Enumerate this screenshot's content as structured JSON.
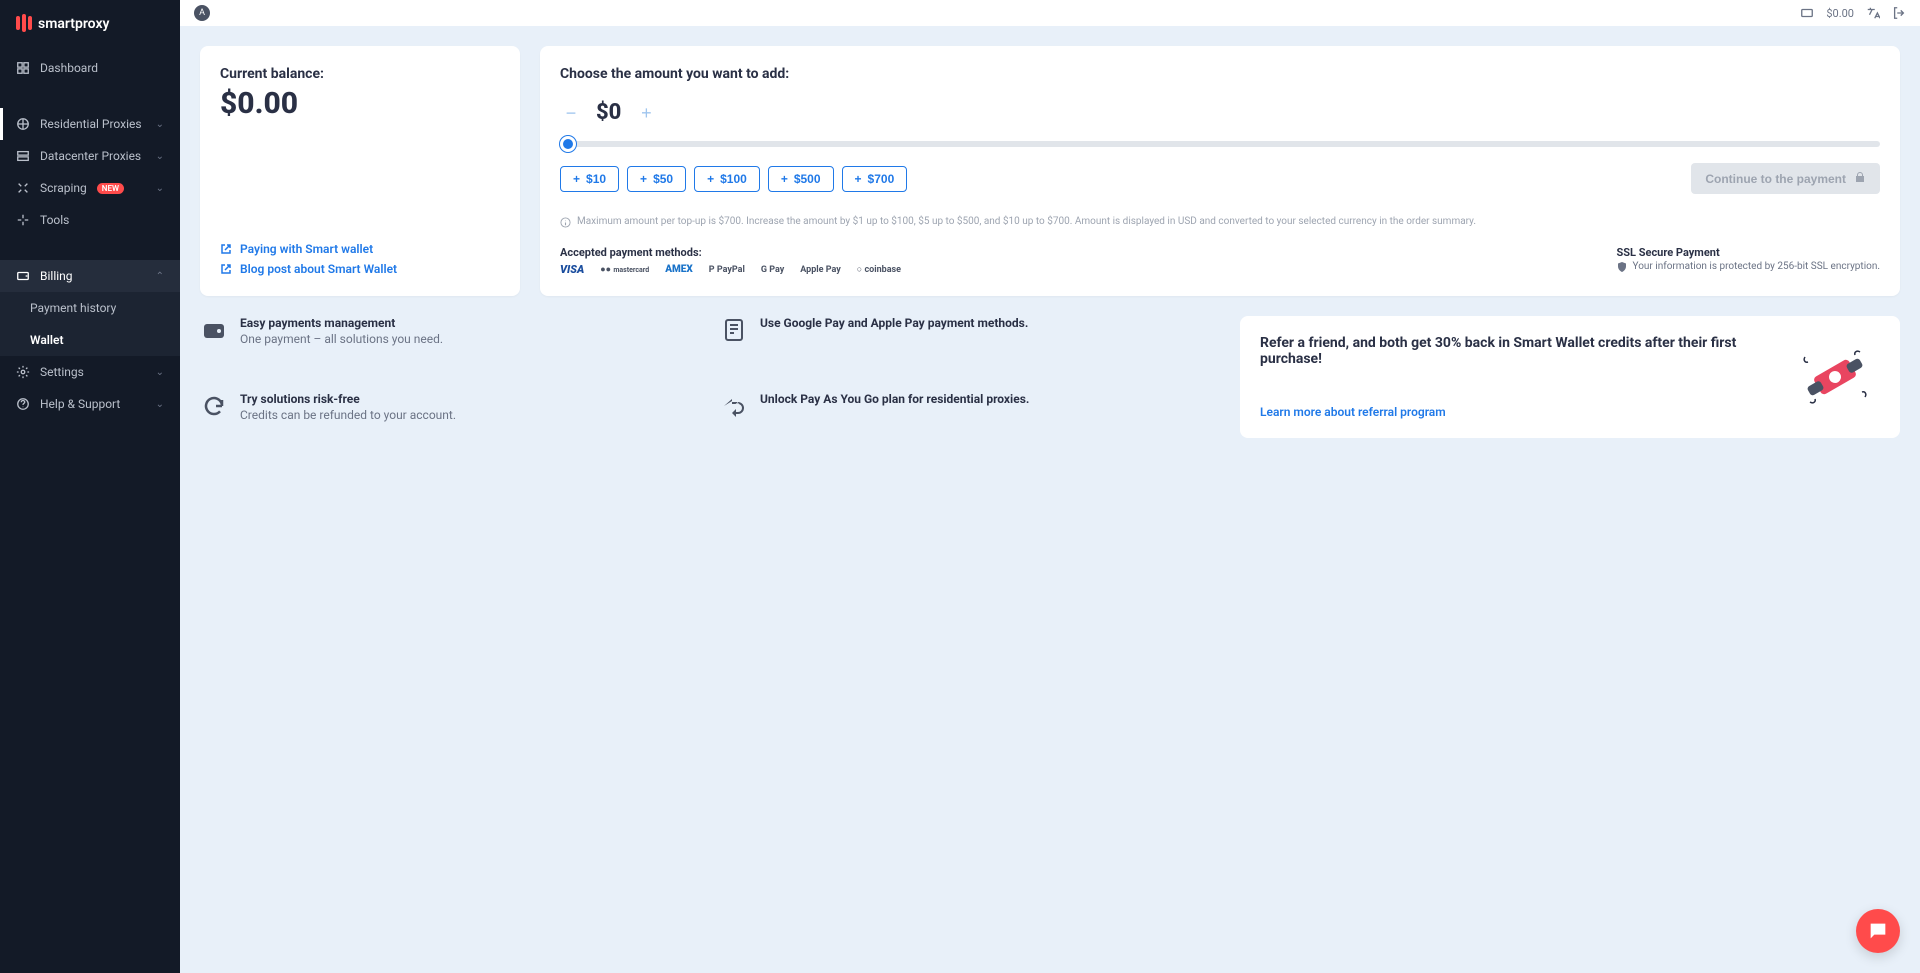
{
  "brand": "smartproxy",
  "topbar": {
    "avatar_initial": "A",
    "balance": "$0.00"
  },
  "sidebar": {
    "dashboard": "Dashboard",
    "residential": "Residential Proxies",
    "datacenter": "Datacenter Proxies",
    "scraping": "Scraping",
    "scraping_badge": "NEW",
    "tools": "Tools",
    "billing": "Billing",
    "payment_history": "Payment history",
    "wallet": "Wallet",
    "settings": "Settings",
    "help": "Help & Support"
  },
  "balance": {
    "title": "Current balance:",
    "amount": "$0.00",
    "link1": "Paying with Smart wallet",
    "link2": "Blog post about Smart Wallet"
  },
  "topup": {
    "title": "Choose the amount you want to add:",
    "amount": "$0",
    "quick": [
      "$10",
      "$50",
      "$100",
      "$500",
      "$700"
    ],
    "continue": "Continue to the payment",
    "fine_print": "Maximum amount per top-up is $700. Increase the amount by $1 up to $100, $5 up to $500, and $10 up to $700. Amount is displayed in USD and converted to your selected currency in the order summary.",
    "accepted_title": "Accepted payment methods:",
    "pay_methods": [
      "VISA",
      "mastercard",
      "AMEX",
      "PayPal",
      "G Pay",
      "Apple Pay",
      "coinbase"
    ],
    "ssl_title": "SSL Secure Payment",
    "ssl_desc": "Your information is protected by 256-bit SSL encryption."
  },
  "features": {
    "f1": {
      "title": "Easy payments management",
      "desc": "One payment – all solutions you need."
    },
    "f2": {
      "title": "Use Google Pay and Apple Pay payment methods.",
      "desc": ""
    },
    "f3": {
      "title": "Try solutions risk-free",
      "desc": "Credits can be refunded to your account."
    },
    "f4": {
      "title": "Unlock Pay As You Go plan for residential proxies.",
      "desc": ""
    }
  },
  "referral": {
    "title": "Refer a friend, and both get 30% back in Smart Wallet credits after their first purchase!",
    "link": "Learn more about referral program"
  }
}
